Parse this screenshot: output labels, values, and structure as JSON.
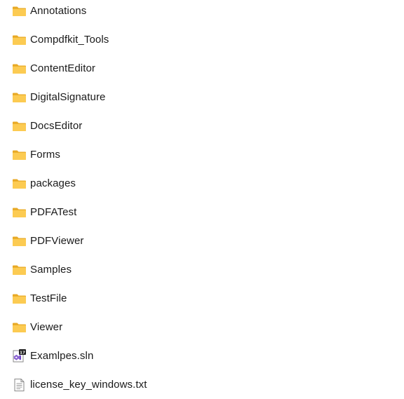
{
  "items": [
    {
      "name": "Annotations",
      "type": "folder",
      "icon": "folder-icon"
    },
    {
      "name": "Compdfkit_Tools",
      "type": "folder",
      "icon": "folder-icon"
    },
    {
      "name": "ContentEditor",
      "type": "folder",
      "icon": "folder-icon"
    },
    {
      "name": "DigitalSignature",
      "type": "folder",
      "icon": "folder-icon"
    },
    {
      "name": "DocsEditor",
      "type": "folder",
      "icon": "folder-icon"
    },
    {
      "name": "Forms",
      "type": "folder",
      "icon": "folder-icon"
    },
    {
      "name": "packages",
      "type": "folder",
      "icon": "folder-icon"
    },
    {
      "name": "PDFATest",
      "type": "folder",
      "icon": "folder-icon"
    },
    {
      "name": "PDFViewer",
      "type": "folder",
      "icon": "folder-icon"
    },
    {
      "name": "Samples",
      "type": "folder",
      "icon": "folder-icon"
    },
    {
      "name": "TestFile",
      "type": "folder",
      "icon": "folder-icon"
    },
    {
      "name": "Viewer",
      "type": "folder",
      "icon": "folder-icon"
    },
    {
      "name": "Examlpes.sln",
      "type": "solution",
      "icon": "visual-studio-solution-icon",
      "badge": "17"
    },
    {
      "name": "license_key_windows.txt",
      "type": "text",
      "icon": "text-file-icon"
    }
  ],
  "colors": {
    "folder_back": "#E8A925",
    "folder_front": "#FCCB52",
    "vs_purple": "#8A63D2",
    "badge_bg": "#1E1E1E"
  }
}
